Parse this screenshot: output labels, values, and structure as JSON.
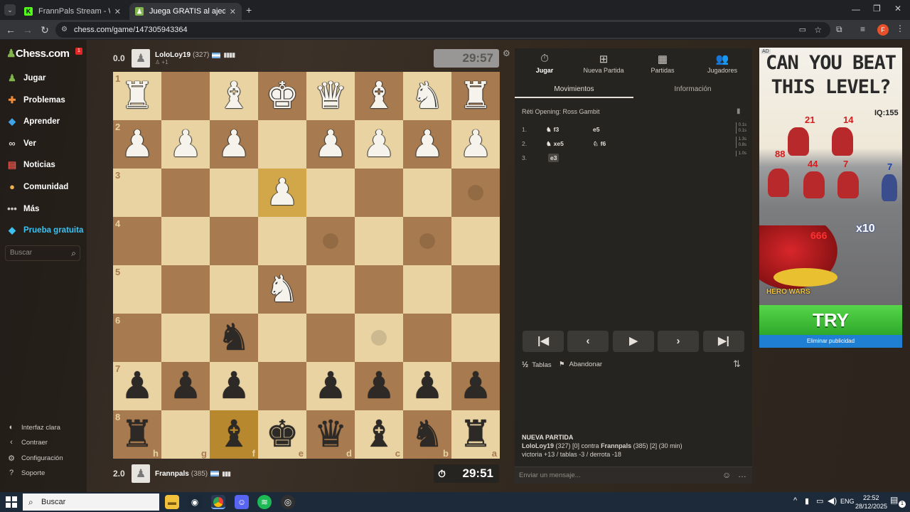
{
  "browser": {
    "tabs": [
      {
        "label": "FrannPals Stream - Watch Live o",
        "icon": "kick-icon",
        "active": false
      },
      {
        "label": "Juega GRATIS al ajedrez online",
        "icon": "chess-icon",
        "active": true
      }
    ],
    "url": "chess.com/game/147305943364",
    "profile_initial": "F"
  },
  "sidebar": {
    "logo": "Chess.com",
    "badge": "1",
    "items": [
      {
        "label": "Jugar",
        "icon": "play-icon",
        "color": "#81b64c"
      },
      {
        "label": "Problemas",
        "icon": "puzzle-icon",
        "color": "#f08c3a"
      },
      {
        "label": "Aprender",
        "icon": "learn-icon",
        "color": "#3fa4ea"
      },
      {
        "label": "Ver",
        "icon": "binoculars-icon",
        "color": "#d8d2cc"
      },
      {
        "label": "Noticias",
        "icon": "news-icon",
        "color": "#e4514a"
      },
      {
        "label": "Comunidad",
        "icon": "community-icon",
        "color": "#f0b04d"
      },
      {
        "label": "Más",
        "icon": "more-icon",
        "color": "#cfcac4"
      },
      {
        "label": "Prueba gratuita",
        "icon": "diamond-icon",
        "color": "#3ec1f0"
      }
    ],
    "search_placeholder": "Buscar",
    "bottom": [
      {
        "label": "Interfaz clara",
        "icon": "theme-icon"
      },
      {
        "label": "Contraer",
        "icon": "collapse-icon"
      },
      {
        "label": "Configuración",
        "icon": "gear-icon"
      },
      {
        "label": "Soporte",
        "icon": "help-icon"
      }
    ]
  },
  "top_player": {
    "score": "0.0",
    "name": "LoloLoy19",
    "rating": "(327)",
    "extra": "+1",
    "clock": "29:57"
  },
  "bottom_player": {
    "score": "2.0",
    "name": "Frannpals",
    "rating": "(385)",
    "clock": "29:51"
  },
  "board": {
    "rank_labels": [
      "1",
      "2",
      "3",
      "4",
      "5",
      "6",
      "7",
      "8"
    ],
    "file_labels": [
      "h",
      "g",
      "f",
      "e",
      "d",
      "c",
      "b",
      "a"
    ],
    "rows": [
      [
        "wR",
        "",
        "wB",
        "wK",
        "wQ",
        "wB",
        "wN",
        "wR"
      ],
      [
        "wP",
        "wP",
        "wP",
        "",
        "wP",
        "wP",
        "wP",
        "wP"
      ],
      [
        "",
        "",
        "",
        "wP",
        "",
        "",
        "",
        ""
      ],
      [
        "",
        "",
        "",
        "",
        "",
        "",
        "",
        ""
      ],
      [
        "",
        "",
        "",
        "wN",
        "",
        "",
        "",
        ""
      ],
      [
        "",
        "",
        "bN",
        "",
        "",
        "",
        "",
        ""
      ],
      [
        "bP",
        "bP",
        "bP",
        "",
        "bP",
        "bP",
        "bP",
        "bP"
      ],
      [
        "bR",
        "",
        "bB",
        "bK",
        "bQ",
        "bB",
        "bN",
        "bR"
      ]
    ]
  },
  "panel": {
    "tabs": [
      {
        "label": "Jugar",
        "icon": "timer-icon"
      },
      {
        "label": "Nueva Partida",
        "icon": "plus-icon"
      },
      {
        "label": "Partidas",
        "icon": "board-icon"
      },
      {
        "label": "Jugadores",
        "icon": "players-icon"
      }
    ],
    "subtabs": [
      "Movimientos",
      "Información"
    ],
    "opening": "Réti Opening: Ross Gambit",
    "moves": [
      {
        "num": "1.",
        "white": "f3",
        "black": "e5",
        "times": [
          "0.1s",
          "0.1s"
        ]
      },
      {
        "num": "2.",
        "white": "xe5",
        "black": "f6",
        "times": [
          "1.3s",
          "0.8s"
        ]
      },
      {
        "num": "3.",
        "white": "e3",
        "black": "",
        "times": [
          "1.0s"
        ]
      }
    ],
    "actions": {
      "draw": "Tablas",
      "resign": "Abandonar"
    },
    "new_game_title": "NUEVA PARTIDA",
    "new_game_line1_a": "LoloLoy19",
    "new_game_line1_b": " (327) [0] contra ",
    "new_game_line1_c": "Frannpals",
    "new_game_line1_d": " (385) [2] (30 min)",
    "new_game_line2": "victoria +13 / tablas -3 / derrota -18",
    "chat_placeholder": "Enviar un mensaje..."
  },
  "ad": {
    "tag": "AD",
    "headline1": "CAN YOU BEAT",
    "headline2": "THIS LEVEL?",
    "iq": "IQ:155",
    "numbers": [
      "21",
      "14",
      "88",
      "44",
      "7",
      "7",
      "666",
      "x10"
    ],
    "brand": "HERO WARS",
    "cta": "TRY",
    "remove": "Eliminar publicidad"
  },
  "taskbar": {
    "search": "Buscar",
    "lang": "ENG",
    "time": "22:52",
    "date": "28/12/2025",
    "notif": "1"
  }
}
